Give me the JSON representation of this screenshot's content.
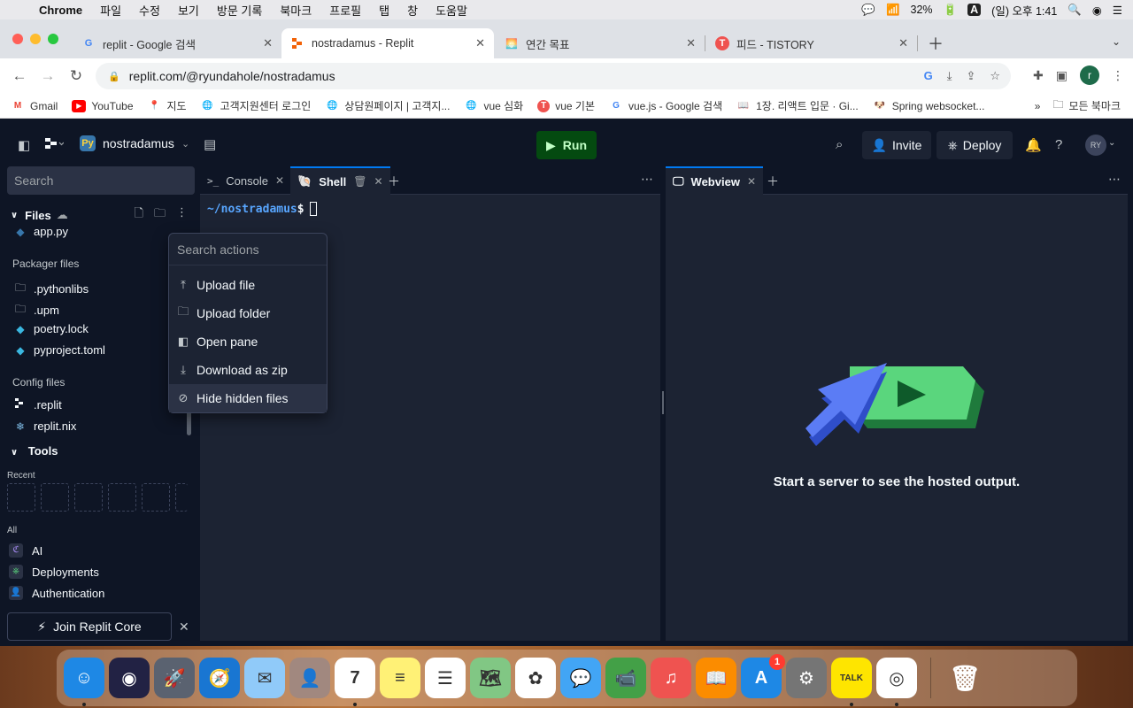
{
  "menubar": {
    "app": "Chrome",
    "items": [
      "파일",
      "수정",
      "보기",
      "방문 기록",
      "북마크",
      "프로필",
      "탭",
      "창",
      "도움말"
    ],
    "battery": "32%",
    "input_source": "A",
    "datetime": "(일) 오후 1:41"
  },
  "browser": {
    "tabs": [
      {
        "title": "replit - Google 검색",
        "favicon": "G"
      },
      {
        "title": "nostradamus - Replit",
        "favicon": "R"
      },
      {
        "title": "연간 목표",
        "favicon": "🌅"
      },
      {
        "title": "피드 - TISTORY",
        "favicon": "T"
      }
    ],
    "url": "replit.com/@ryundahole/nostradamus",
    "profile_initial": "r",
    "bookmarks": [
      {
        "label": "Gmail",
        "icon": "M",
        "color": "#ea4335"
      },
      {
        "label": "YouTube",
        "icon": "▶",
        "color": "#ff0000"
      },
      {
        "label": "지도",
        "icon": "📍",
        "color": "#34a853"
      },
      {
        "label": "고객지원센터 로그인",
        "icon": "🌐",
        "color": "#555555"
      },
      {
        "label": "상담원페이지 | 고객지...",
        "icon": "🌐",
        "color": "#555555"
      },
      {
        "label": "vue 심화",
        "icon": "🌐",
        "color": "#555555"
      },
      {
        "label": "vue 기본",
        "icon": "T",
        "color": "#ef5350"
      },
      {
        "label": "vue.js - Google 검색",
        "icon": "G",
        "color": "#4285f4"
      },
      {
        "label": "1장. 리액트 입문 · Gi...",
        "icon": "📖",
        "color": "#333333"
      },
      {
        "label": "Spring websocket...",
        "icon": "🐶",
        "color": "#c8a060"
      }
    ],
    "all_bookmarks": "모든 북마크"
  },
  "replit": {
    "repl_name": "nostradamus",
    "run_label": "Run",
    "invite_label": "Invite",
    "deploy_label": "Deploy",
    "user_initials": "RY",
    "sidebar": {
      "search_placeholder": "Search",
      "files_label": "Files",
      "first_file": "app.py",
      "packager_label": "Packager files",
      "packager_files": [
        ".pythonlibs",
        ".upm",
        "poetry.lock",
        "pyproject.toml"
      ],
      "config_label": "Config files",
      "config_files": [
        ".replit",
        "replit.nix"
      ],
      "tools_label": "Tools",
      "recent_label": "Recent",
      "all_label": "All",
      "tools": [
        "AI",
        "Deployments",
        "Authentication"
      ],
      "join_core": "Join Replit Core"
    },
    "shell_pane": {
      "tabs": [
        "Console",
        "Shell"
      ],
      "prompt": "~/nostradamus",
      "prompt_symbol": "$"
    },
    "webview_pane": {
      "tab": "Webview",
      "message": "Start a server to see the hosted output."
    },
    "actions_menu": {
      "search_placeholder": "Search actions",
      "items": [
        "Upload file",
        "Upload folder",
        "Open pane",
        "Download as zip",
        "Hide hidden files"
      ]
    }
  },
  "dock": {
    "apps": [
      {
        "name": "Finder",
        "color": "#1e88e5",
        "label": "☺"
      },
      {
        "name": "Siri",
        "color": "#222244",
        "label": "◉"
      },
      {
        "name": "Launchpad",
        "color": "#5a6270",
        "label": "🚀"
      },
      {
        "name": "Safari",
        "color": "#1976d2",
        "label": "🧭"
      },
      {
        "name": "Mail",
        "color": "#90caf9",
        "label": "✉"
      },
      {
        "name": "Contacts",
        "color": "#a1887f",
        "label": "👤"
      },
      {
        "name": "Calendar",
        "color": "#ffffff",
        "label": "7"
      },
      {
        "name": "Notes",
        "color": "#fff176",
        "label": "≡"
      },
      {
        "name": "Reminders",
        "color": "#ffffff",
        "label": "☰"
      },
      {
        "name": "Maps",
        "color": "#81c784",
        "label": "🗺"
      },
      {
        "name": "Photos",
        "color": "#ffffff",
        "label": "✿"
      },
      {
        "name": "Messages",
        "color": "#42a5f5",
        "label": "💬"
      },
      {
        "name": "FaceTime",
        "color": "#43a047",
        "label": "📹"
      },
      {
        "name": "Music",
        "color": "#ef5350",
        "label": "♫"
      },
      {
        "name": "Books",
        "color": "#fb8c00",
        "label": "📖"
      },
      {
        "name": "App Store",
        "color": "#1e88e5",
        "label": "A",
        "badge": "1"
      },
      {
        "name": "System Preferences",
        "color": "#757575",
        "label": "⚙"
      },
      {
        "name": "KakaoTalk",
        "color": "#fee500",
        "label": "TALK"
      },
      {
        "name": "Chrome",
        "color": "#ffffff",
        "label": "◎"
      }
    ],
    "trash": {
      "name": "Trash",
      "color": "#cfd8dc",
      "label": "🗑"
    }
  }
}
